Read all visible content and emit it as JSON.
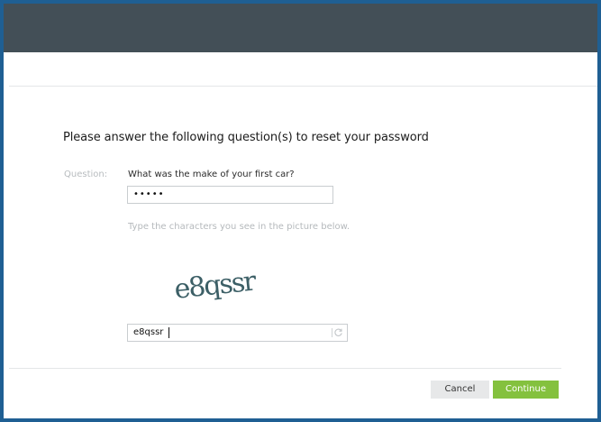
{
  "page": {
    "heading": "Please answer the following question(s) to reset your password"
  },
  "question": {
    "label": "Question:",
    "text": "What was the make of your first car?",
    "answer_masked": "•••••"
  },
  "captcha": {
    "hint": "Type the characters you see in the picture below.",
    "image_text": "e8qssr",
    "input_value": "e8qssr"
  },
  "actions": {
    "cancel_label": "Cancel",
    "continue_label": "Continue"
  },
  "colors": {
    "topbar": "#434f57",
    "frame_border": "#1f5f93",
    "continue_button": "#84c13e",
    "cancel_button": "#e7e8e9",
    "captcha_text": "#3c5f66"
  },
  "icons": {
    "refresh": "refresh-icon"
  }
}
